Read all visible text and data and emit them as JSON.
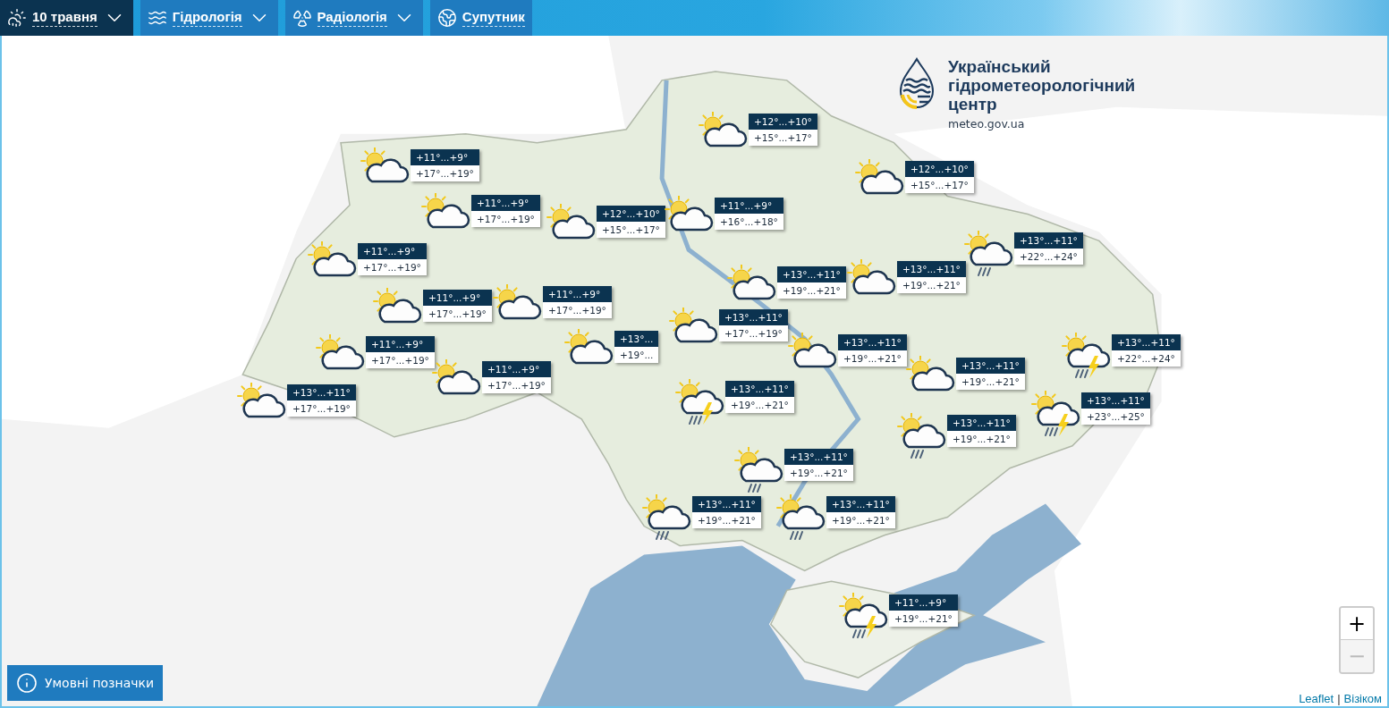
{
  "tabs": [
    {
      "label": "10 травня",
      "kind": "dropdown",
      "selected": true
    },
    {
      "label": "Гідрологія",
      "kind": "dropdown",
      "selected": false
    },
    {
      "label": "Радіологія",
      "kind": "dropdown",
      "selected": false
    },
    {
      "label": "Супутник",
      "kind": "link",
      "selected": false
    }
  ],
  "logo": {
    "title": "Український гідрометеорологічний центр",
    "site": "meteo.gov.ua"
  },
  "forecast_markers": [
    {
      "kind": "partly-cloudy",
      "night": "+12°...+10°",
      "day": "+15°...+17°"
    },
    {
      "kind": "partly-cloudy",
      "night": "+11°...+9°",
      "day": "+17°...+19°"
    },
    {
      "kind": "partly-cloudy",
      "night": "+12°...+10°",
      "day": "+15°...+17°"
    },
    {
      "kind": "partly-cloudy",
      "night": "+11°...+9°",
      "day": "+17°...+19°"
    },
    {
      "kind": "partly-cloudy",
      "night": "+12°...+10°",
      "day": "+15°...+17°"
    },
    {
      "kind": "partly-cloudy",
      "night": "+11°...+9°",
      "day": "+16°...+18°"
    },
    {
      "kind": "partly-cloudy",
      "night": "+11°...+9°",
      "day": "+17°...+19°"
    },
    {
      "kind": "rain",
      "night": "+13°...+11°",
      "day": "+22°...+24°"
    },
    {
      "kind": "partly-cloudy",
      "night": "+13°...+11°",
      "day": "+19°...+21°"
    },
    {
      "kind": "partly-cloudy",
      "night": "+13°...+11°",
      "day": "+19°...+21°"
    },
    {
      "kind": "partly-cloudy",
      "night": "+11°...+9°",
      "day": "+17°...+19°"
    },
    {
      "kind": "partly-cloudy",
      "night": "+11°...+9°",
      "day": "+17°...+19°"
    },
    {
      "kind": "partly-cloudy",
      "night": "+13°...+11°",
      "day": "+17°...+19°"
    },
    {
      "kind": "partly-cloudy",
      "night": "+11°...+9°",
      "day": "+17°...+19°"
    },
    {
      "kind": "partly-cloudy",
      "night": "+13°...",
      "day": "+19°..."
    },
    {
      "kind": "partly-cloudy",
      "night": "+13°...+11°",
      "day": "+19°...+21°"
    },
    {
      "kind": "thunderstorm",
      "night": "+13°...+11°",
      "day": "+22°...+24°"
    },
    {
      "kind": "partly-cloudy",
      "night": "+11°...+9°",
      "day": "+17°...+19°"
    },
    {
      "kind": "partly-cloudy",
      "night": "+13°...+11°",
      "day": "+19°...+21°"
    },
    {
      "kind": "partly-cloudy",
      "night": "+13°...+11°",
      "day": "+17°...+19°"
    },
    {
      "kind": "thunderstorm",
      "night": "+13°...+11°",
      "day": "+19°...+21°"
    },
    {
      "kind": "thunderstorm",
      "night": "+13°...+11°",
      "day": "+23°...+25°"
    },
    {
      "kind": "rain",
      "night": "+13°...+11°",
      "day": "+19°...+21°"
    },
    {
      "kind": "rain",
      "night": "+13°...+11°",
      "day": "+19°...+21°"
    },
    {
      "kind": "rain",
      "night": "+13°...+11°",
      "day": "+19°...+21°"
    },
    {
      "kind": "rain",
      "night": "+13°...+11°",
      "day": "+19°...+21°"
    },
    {
      "kind": "thunderstorm",
      "night": "+11°...+9°",
      "day": "+19°...+21°"
    }
  ],
  "zoom_buttons": [
    {
      "label": "+",
      "disabled": false
    },
    {
      "label": "−",
      "disabled": true
    }
  ],
  "legend_button": {
    "label": "Умовні позначки"
  },
  "attribution": {
    "links": [
      "Leaflet",
      "Візіком"
    ],
    "separator": "|"
  }
}
